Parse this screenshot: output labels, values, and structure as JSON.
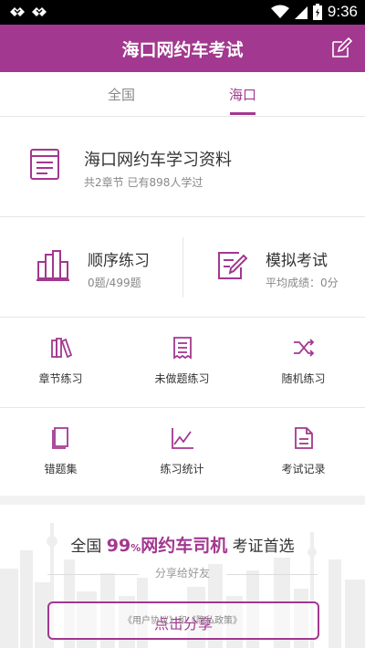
{
  "status_bar": {
    "time": "9:36",
    "icons": [
      "sync-icon",
      "sync-icon",
      "wifi-icon",
      "signal-icon",
      "battery-icon"
    ]
  },
  "header": {
    "title": "海口网约车考试",
    "edit_icon": "edit-icon"
  },
  "tabs": [
    {
      "label": "全国",
      "selected": false
    },
    {
      "label": "海口",
      "selected": true
    }
  ],
  "material": {
    "title": "海口网约车学习资料",
    "subtitle": "共2章节   已有898人学过",
    "icon": "document-icon"
  },
  "practice": {
    "label": "顺序练习",
    "sub": "0题/499题",
    "icon": "books-icon"
  },
  "mock": {
    "label": "模拟考试",
    "sub": "平均成绩：0分",
    "icon": "exam-edit-icon"
  },
  "grid": [
    {
      "label": "章节练习",
      "icon": "chapter-icon"
    },
    {
      "label": "未做题练习",
      "icon": "receipt-icon"
    },
    {
      "label": "随机练习",
      "icon": "shuffle-icon"
    },
    {
      "label": "错题集",
      "icon": "notebook-icon"
    },
    {
      "label": "练习统计",
      "icon": "chart-line-icon"
    },
    {
      "label": "考试记录",
      "icon": "file-icon"
    }
  ],
  "promo": {
    "prefix": "全国",
    "highlight_num": "99",
    "highlight_pct": "%",
    "highlight_text": "网约车司机",
    "suffix": "考证首选",
    "share_text": "分享给好友",
    "button_label": "点击分享",
    "agreement": "《用户协议》和《隐私政策》"
  },
  "colors": {
    "accent": "#a2388f",
    "status_bar": "#000000"
  }
}
